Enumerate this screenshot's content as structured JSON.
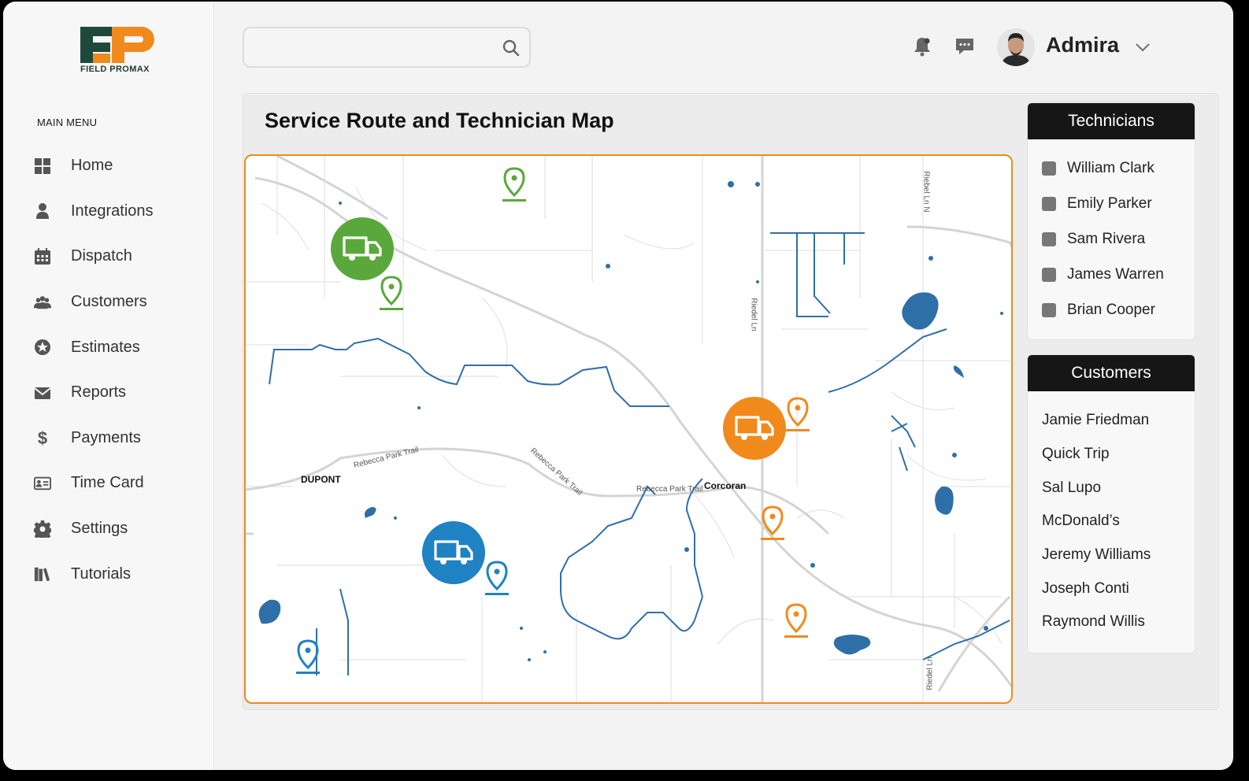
{
  "brand": {
    "logo_text": "FIELD PROMAX",
    "primary_color": "#1d4a3a",
    "accent_color": "#f08a1c"
  },
  "sidebar": {
    "menu_title": "MAIN MENU",
    "items": [
      {
        "label": "Home",
        "icon": "grid-icon"
      },
      {
        "label": "Integrations",
        "icon": "person-icon"
      },
      {
        "label": "Dispatch",
        "icon": "calendar-icon"
      },
      {
        "label": "Customers",
        "icon": "group-icon"
      },
      {
        "label": "Estimates",
        "icon": "star-badge-icon"
      },
      {
        "label": "Reports",
        "icon": "envelope-icon"
      },
      {
        "label": "Payments",
        "icon": "dollar-icon"
      },
      {
        "label": "Time Card",
        "icon": "id-card-icon"
      },
      {
        "label": "Settings",
        "icon": "gear-icon"
      },
      {
        "label": "Tutorials",
        "icon": "books-icon"
      }
    ]
  },
  "header": {
    "search": {
      "placeholder": "",
      "value": ""
    },
    "user_name": "Admira"
  },
  "main": {
    "title": "Service Route and Technician Map",
    "map": {
      "labels": {
        "dupont": "DUPONT",
        "corcoran": "Corcoran",
        "road1": "Rebecca Park Trail",
        "road2": "Rebecca Park Trail",
        "road3": "Rebecca Park Trail",
        "riedel1": "Riedel Ln",
        "riedel2": "Riebel Ln N",
        "riedel3": "Riedel Ln"
      },
      "trucks": [
        {
          "color": "#5aa83c"
        },
        {
          "color": "#f08a1c"
        },
        {
          "color": "#1f82c3"
        }
      ]
    }
  },
  "technicians": {
    "title": "Technicians",
    "items": [
      "William Clark",
      "Emily Parker",
      "Sam Rivera",
      "James Warren",
      "Brian Cooper"
    ]
  },
  "customers": {
    "title": "Customers",
    "items": [
      "Jamie Friedman",
      "Quick Trip",
      "Sal Lupo",
      "McDonald’s",
      "Jeremy Williams",
      "Joseph Conti",
      "Raymond Willis"
    ]
  }
}
